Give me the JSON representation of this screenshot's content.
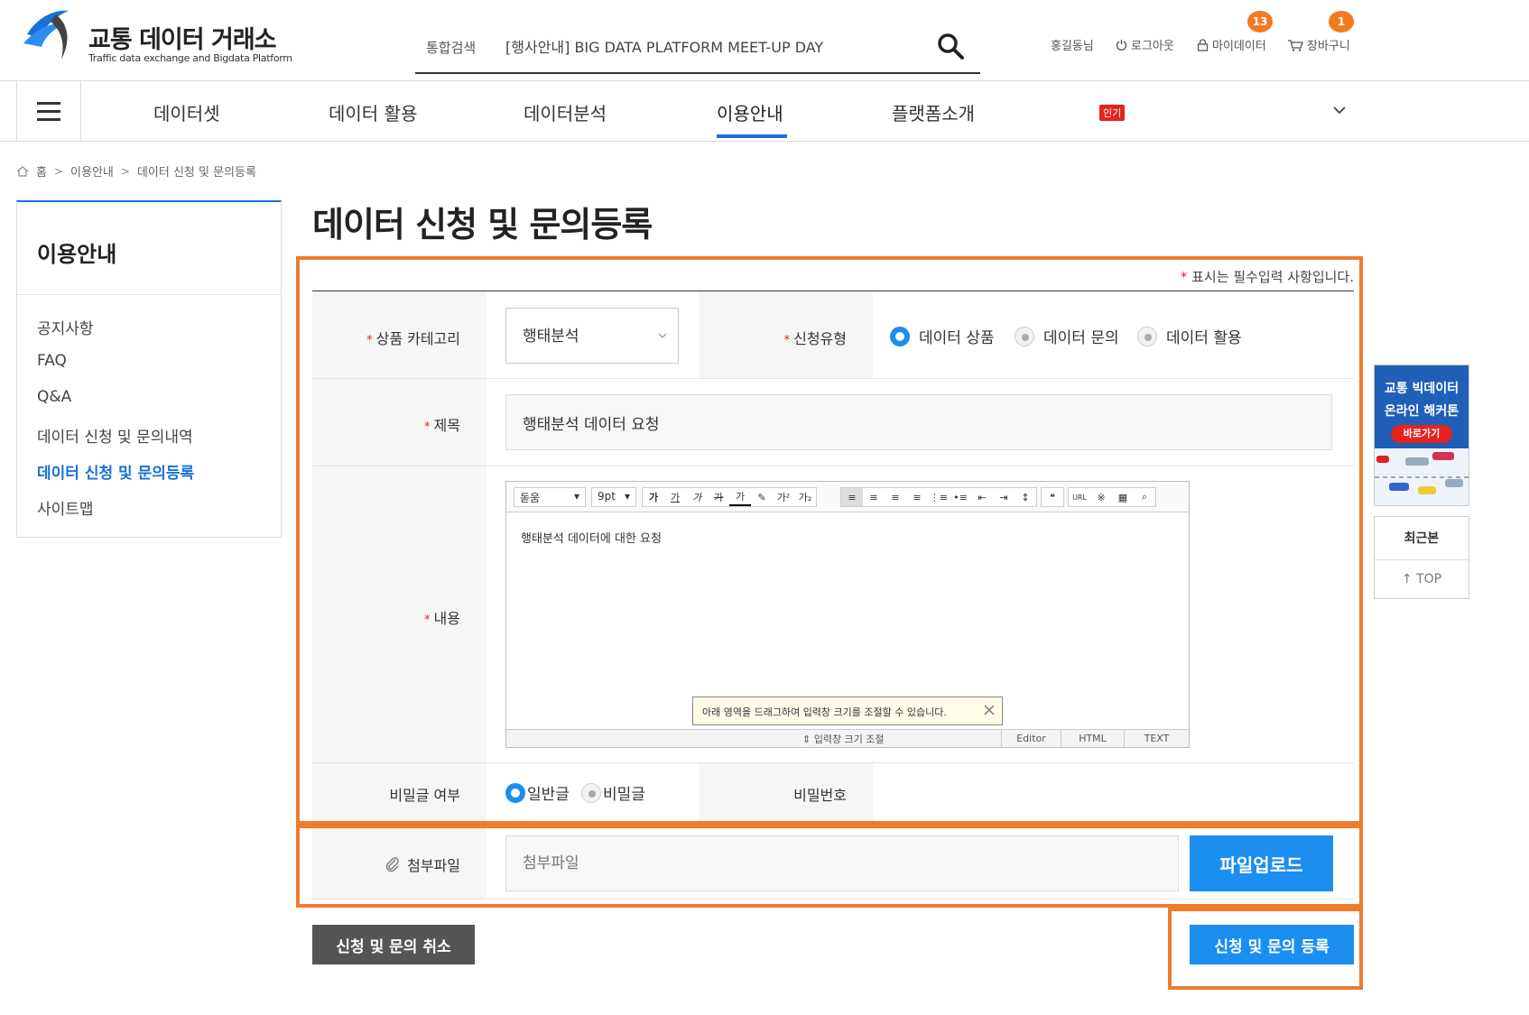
{
  "header": {
    "logo_title": "교통 데이터 거래소",
    "logo_subtitle": "Traffic data exchange and Bigdata Platform",
    "search_label": "통합검색",
    "search_value": "[행사안내] BIG DATA PLATFORM MEET-UP DAY",
    "user_name": "홍길동님",
    "logout": "로그아웃",
    "mydata": "마이데이터",
    "mydata_count": "13",
    "cart": "장바구니",
    "cart_count": "1"
  },
  "gnb": {
    "items": [
      "데이터셋",
      "데이터 활용",
      "데이터분석",
      "이용안내",
      "플랫폼소개"
    ],
    "active_index": 3,
    "hot_badge": "인기"
  },
  "breadcrumb": [
    "홈",
    "이용안내",
    "데이터 신청 및 문의등록"
  ],
  "sidebar": {
    "title": "이용안내",
    "items": [
      "공지사항",
      "FAQ",
      "Q&A",
      "데이터 신청 및 문의내역",
      "데이터 신청 및 문의등록",
      "사이트맵"
    ],
    "active_index": 4
  },
  "page": {
    "title": "데이터 신청 및 문의등록",
    "required_note": "표시는 필수입력 사항입니다."
  },
  "form": {
    "category_label": "상품 카테고리",
    "category_value": "행태분석",
    "type_label": "신청유형",
    "type_options": [
      "데이터 상품",
      "데이터 문의",
      "데이터 활용"
    ],
    "type_selected": 0,
    "title_label": "제목",
    "title_value": "행태분석 데이터 요청",
    "content_label": "내용",
    "content_value": "행태분석 데이터에 대한 요청",
    "secret_label": "비밀글 여부",
    "secret_options": [
      "일반글",
      "비밀글"
    ],
    "secret_selected": 0,
    "password_label": "비밀번호",
    "attach_label": "첨부파일",
    "attach_placeholder": "첨부파일",
    "upload_button": "파일업로드"
  },
  "editor": {
    "font_select": "돋움",
    "size_select": "9pt",
    "tooltip": "아래 영역을 드래그하여 입력창 크기를 조절할 수 있습니다.",
    "resize_label": "입력창 크기 조절",
    "modes": [
      "Editor",
      "HTML",
      "TEXT"
    ]
  },
  "actions": {
    "cancel": "신청 및 문의 취소",
    "submit": "신청 및 문의 등록"
  },
  "floating": {
    "banner_title_1": "교통 빅데이터",
    "banner_title_2": "온라인 해커톤",
    "banner_button": "바로가기",
    "recent": "최근본",
    "top": "TOP"
  },
  "colors": {
    "accent": "#1c8ef0",
    "active_nav": "#1c6fd8",
    "highlight": "#ee7c2c",
    "badge": "#f47a20",
    "required": "#e4231f"
  }
}
